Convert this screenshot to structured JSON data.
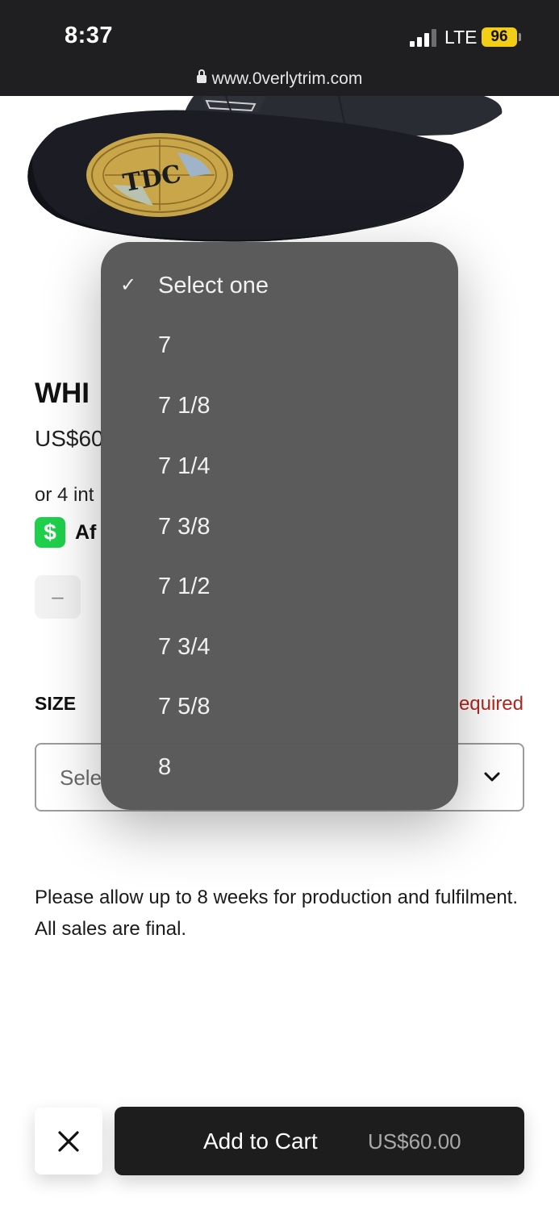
{
  "status_bar": {
    "time": "8:37",
    "network": "LTE",
    "battery": "96"
  },
  "browser": {
    "url": "www.0verlytrim.com"
  },
  "product": {
    "image_alt": "TDC",
    "title": "WHI",
    "price": "US$60",
    "installments_text": "or 4 int",
    "afterpay_label": "Af",
    "cashapp_symbol": "$",
    "quantity_minus": "–"
  },
  "size": {
    "label": "SIZE",
    "required": "equired",
    "select_value": "Sele",
    "options": [
      {
        "label": "Select one",
        "selected": true,
        "check": "✓"
      },
      {
        "label": "7"
      },
      {
        "label": "7 1/8"
      },
      {
        "label": "7 1/4"
      },
      {
        "label": "7 3/8"
      },
      {
        "label": "7 1/2"
      },
      {
        "label": "7 3/4"
      },
      {
        "label": "7 5/8"
      },
      {
        "label": "8"
      }
    ]
  },
  "note": "Please allow up to 8 weeks for production and fulfilment. All sales are final.",
  "bottom_bar": {
    "close_icon": "close-icon",
    "add_to_cart_label": "Add to Cart",
    "add_to_cart_price": "US$60.00"
  },
  "colors": {
    "status_bar_bg": "#1f1f21",
    "battery": "#f3ce17",
    "cashapp_green": "#1fd04b",
    "required_red": "#b3261e",
    "menu_bg": "#565656",
    "cart_button_bg": "#1d1d1d"
  }
}
